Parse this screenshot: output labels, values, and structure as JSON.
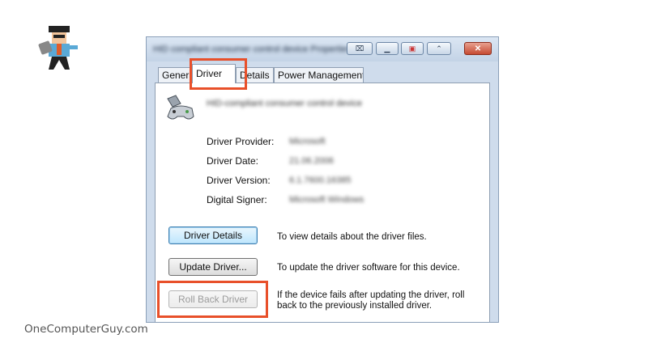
{
  "watermark": "OneComputerGuy.com",
  "dialog": {
    "title": "HID compliant consumer control device Properties",
    "tabs": [
      "General",
      "Driver",
      "Details",
      "Power Management"
    ],
    "active_tab": "Driver",
    "device_name": "HID-compliant consumer control device",
    "fields": [
      {
        "label": "Driver Provider:",
        "value": "Microsoft"
      },
      {
        "label": "Driver Date:",
        "value": "21.06.2006"
      },
      {
        "label": "Driver Version:",
        "value": "6.1.7600.16385"
      },
      {
        "label": "Digital Signer:",
        "value": "Microsoft Windows"
      }
    ],
    "actions": [
      {
        "button": "Driver Details",
        "description": "To view details about the driver files."
      },
      {
        "button": "Update Driver...",
        "description": "To update the driver software for this device."
      },
      {
        "button": "Roll Back Driver",
        "description": "If the device fails after updating the driver, roll back to the previously installed driver."
      }
    ]
  },
  "colors": {
    "highlight": "#e8502a",
    "close_button": "#c64b32"
  },
  "icons": [
    "logo-mascot-icon",
    "device-gamepad-icon",
    "minimize-icon",
    "maximize-icon",
    "close-icon"
  ]
}
